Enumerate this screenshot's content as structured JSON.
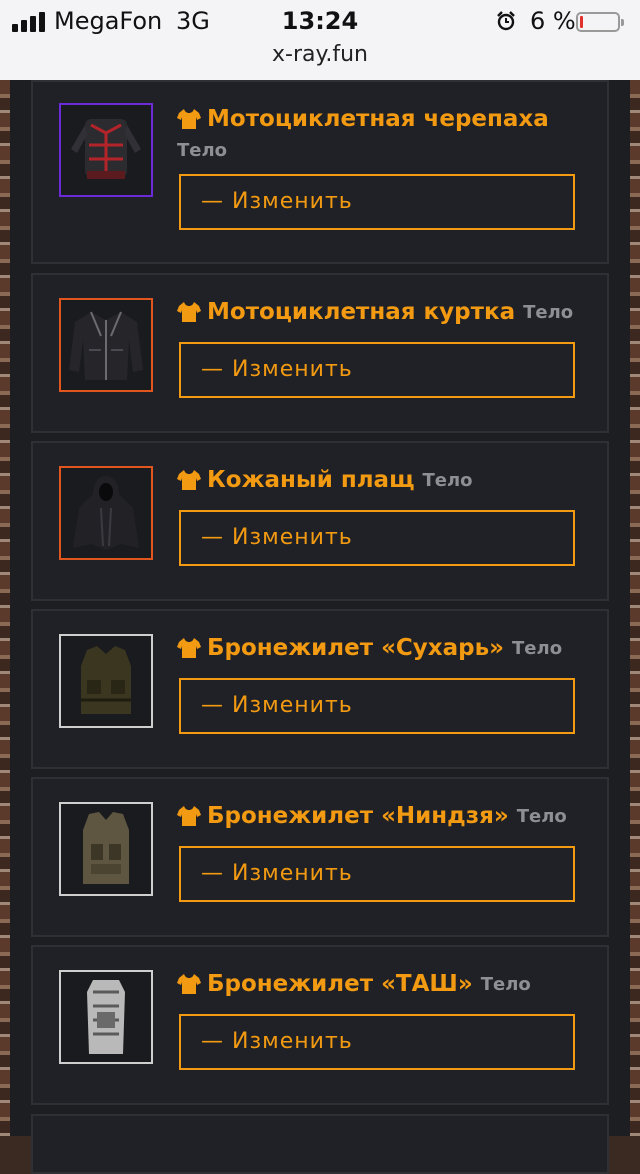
{
  "status_bar": {
    "carrier": "MegaFon",
    "network": "3G",
    "time": "13:24",
    "battery_percent": "6 %",
    "battery_level": 0.06,
    "battery_color": "#e0312c"
  },
  "browser": {
    "url": "x-ray.fun"
  },
  "colors": {
    "accent": "#f29a12",
    "panel": "#1d1e22",
    "card_border": "#2e3036"
  },
  "items": [
    {
      "name": "Мотоциклетная черепаха",
      "slot": "Тело",
      "button": "— Изменить",
      "rarity_color": "#6c2bd9",
      "icon": "shirt-icon"
    },
    {
      "name": "Мотоциклетная куртка",
      "slot": "Тело",
      "button": "— Изменить",
      "rarity_color": "#e1561d",
      "icon": "shirt-icon"
    },
    {
      "name": "Кожаный плащ",
      "slot": "Тело",
      "button": "— Изменить",
      "rarity_color": "#e1561d",
      "icon": "shirt-icon"
    },
    {
      "name": "Бронежилет «Сухарь»",
      "slot": "Тело",
      "button": "— Изменить",
      "rarity_color": "#cfcfcf",
      "icon": "shirt-icon"
    },
    {
      "name": "Бронежилет «Ниндзя»",
      "slot": "Тело",
      "button": "— Изменить",
      "rarity_color": "#cfcfcf",
      "icon": "shirt-icon"
    },
    {
      "name": "Бронежилет «ТАШ»",
      "slot": "Тело",
      "button": "— Изменить",
      "rarity_color": "#cfcfcf",
      "icon": "shirt-icon"
    }
  ]
}
